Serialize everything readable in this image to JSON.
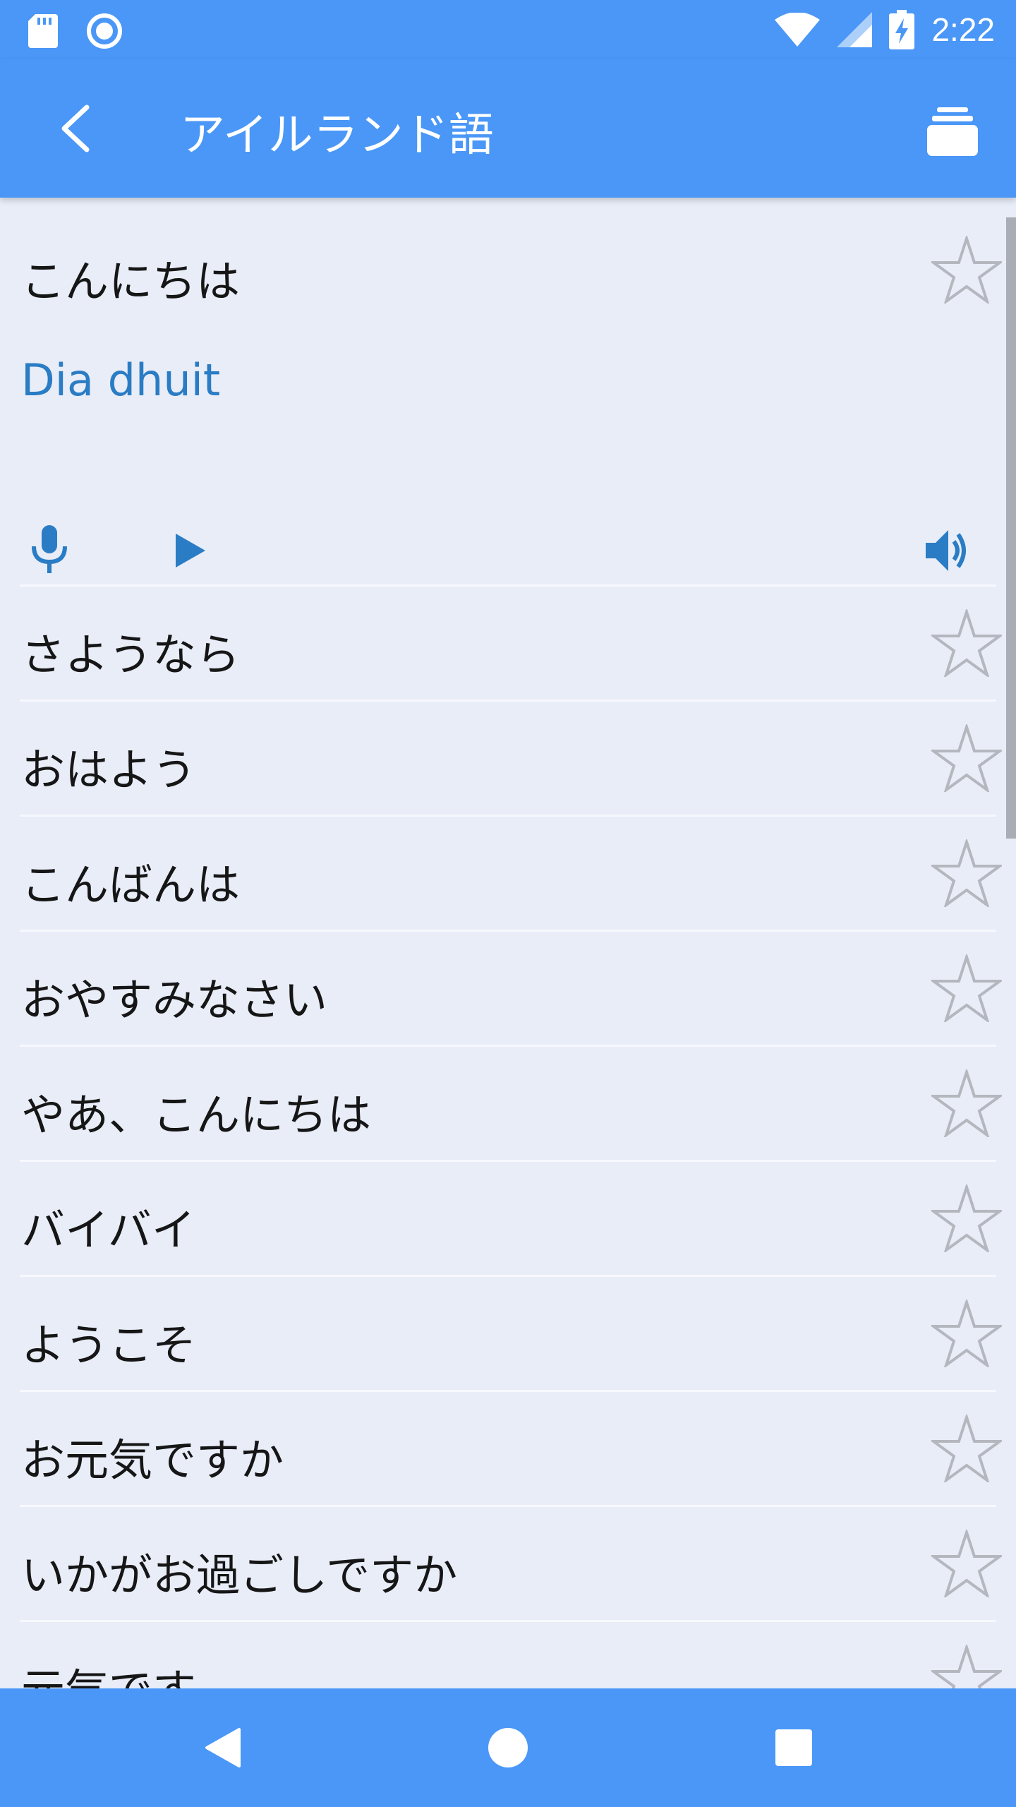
{
  "status_bar": {
    "time": "2:22",
    "left_icons": [
      "sd-card-icon",
      "sync-circle-icon"
    ],
    "right_icons": [
      "wifi-icon",
      "cell-signal-icon",
      "battery-charging-icon"
    ]
  },
  "app_bar": {
    "title": "アイルランド語",
    "back_icon": "back-arrow-icon",
    "menu_icon": "stack-layers-icon"
  },
  "expanded": {
    "phrase": "こんにちは",
    "translation": "Dia dhuit",
    "controls": [
      "mic-icon",
      "play-icon",
      "speaker-icon"
    ]
  },
  "phrases": [
    "さようなら",
    "おはよう",
    "こんばんは",
    "おやすみなさい",
    "やあ、こんにちは",
    "バイバイ",
    "ようこそ",
    "お元気ですか",
    "いかがお過ごしですか",
    "元気です"
  ],
  "colors": {
    "primary": "#4a97f7",
    "accent_text": "#2a7cc4",
    "background": "#e8edf8"
  },
  "nav_bar": {
    "icons": [
      "nav-back-icon",
      "nav-home-icon",
      "nav-recents-icon"
    ]
  }
}
